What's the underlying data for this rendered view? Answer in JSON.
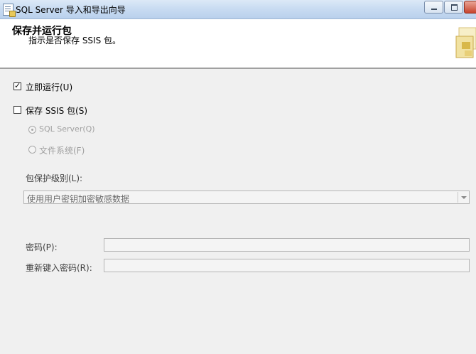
{
  "window": {
    "title": "SQL Server 导入和导出向导",
    "icon": "document-icon"
  },
  "header": {
    "title": "保存并运行包",
    "subtitle": "指示是否保存 SSIS 包。"
  },
  "options": {
    "run_immediately": {
      "label": "立即运行(U)",
      "checked": true
    },
    "save_ssis": {
      "label": "保存 SSIS 包(S)",
      "checked": false
    },
    "sql_server": {
      "label": "SQL Server(Q)",
      "selected": true,
      "enabled": false
    },
    "file_system": {
      "label": "文件系统(F)",
      "selected": false,
      "enabled": false
    }
  },
  "protection": {
    "label": "包保护级别(L):",
    "value": "使用用户密钥加密敏感数据"
  },
  "password": {
    "label": "密码(P):",
    "value": ""
  },
  "retype_password": {
    "label": "重新键入密码(R):",
    "value": ""
  },
  "colors": {
    "title_bar": "#c9dcf2",
    "background": "#f0f0f0",
    "disabled_text": "#a0a0a0"
  }
}
